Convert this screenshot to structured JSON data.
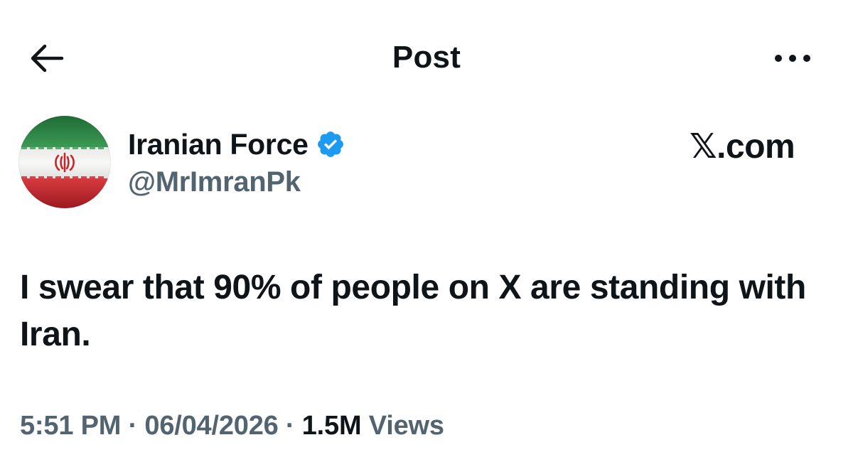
{
  "header": {
    "title": "Post",
    "back_icon": "arrow-left-icon",
    "more_icon": "ellipsis-icon"
  },
  "author": {
    "name": "Iranian Force",
    "handle": "@MrImranPk",
    "verified": true,
    "avatar_icon": "iran-flag-avatar"
  },
  "watermark": {
    "text": "𝕏.com"
  },
  "post": {
    "text": "I swear that 90% of people on X are standing with Iran."
  },
  "meta": {
    "time": "5:51 PM",
    "separator": " · ",
    "date": "06/04/2026",
    "views_count": "1.5M",
    "views_label": " Views"
  },
  "colors": {
    "text_primary": "#0f1419",
    "text_secondary": "#536471",
    "verified_blue": "#1d9bf0",
    "flag_green": "#2e8b4a",
    "flag_white": "#f2f2f2",
    "flag_red": "#c8242c"
  }
}
